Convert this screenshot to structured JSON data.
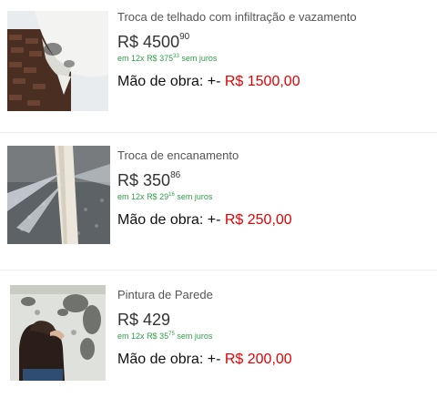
{
  "products": [
    {
      "title": "Troca de telhado com infiltração e vazamento",
      "currency": "R$",
      "price_int": "4500",
      "price_cents": "90",
      "installments_prefix": "em",
      "installments_count": "12x",
      "installment_currency": "R$",
      "installment_int": "375",
      "installment_cents": "33",
      "installments_suffix": "sem juros",
      "labor_label": "Mão de obra: +-",
      "labor_value": "R$ 1500,00",
      "image": "leaking-roof-image"
    },
    {
      "title": "Troca de encanamento",
      "currency": "R$",
      "price_int": "350",
      "price_cents": "86",
      "installments_prefix": "em",
      "installments_count": "12x",
      "installment_currency": "R$",
      "installment_int": "29",
      "installment_cents": "16",
      "installments_suffix": "sem juros",
      "labor_label": "Mão de obra: +-",
      "labor_value": "R$ 250,00",
      "image": "burst-pipe-image"
    },
    {
      "title": "Pintura de Parede",
      "currency": "R$",
      "price_int": "429",
      "price_cents": "",
      "installments_prefix": "em",
      "installments_count": "12x",
      "installment_currency": "R$",
      "installment_int": "35",
      "installment_cents": "75",
      "installments_suffix": "sem juros",
      "labor_label": "Mão de obra: +-",
      "labor_value": "R$ 200,00",
      "image": "moldy-wall-image"
    }
  ],
  "colors": {
    "installment_green": "#2e9e4a",
    "labor_red": "#e60000"
  }
}
